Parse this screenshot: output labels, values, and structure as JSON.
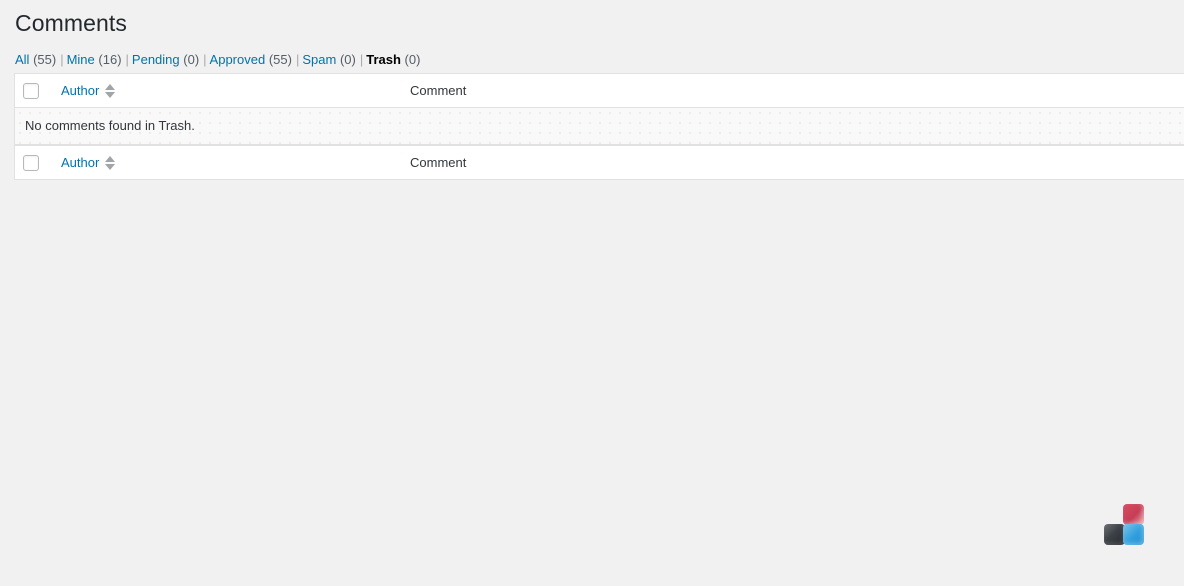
{
  "page": {
    "title": "Comments"
  },
  "views": {
    "separator": "|",
    "items": [
      {
        "label": "All",
        "count": "(55)",
        "current": false
      },
      {
        "label": "Mine",
        "count": "(16)",
        "current": false
      },
      {
        "label": "Pending",
        "count": "(0)",
        "current": false
      },
      {
        "label": "Approved",
        "count": "(55)",
        "current": false
      },
      {
        "label": "Spam",
        "count": "(0)",
        "current": false
      },
      {
        "label": "Trash",
        "count": "(0)",
        "current": true
      }
    ]
  },
  "table": {
    "select_all_label": "Select All",
    "columns": {
      "author": "Author",
      "comment": "Comment"
    },
    "no_items_message": "No comments found in Trash."
  },
  "colors": {
    "link": "#0073aa",
    "background": "#f1f1f1",
    "table_background": "#ffffff",
    "border": "#e1e1e1",
    "text": "#32373c",
    "tile_pink": "#c63d55",
    "tile_dark": "#24282c",
    "tile_blue": "#1f8ecd"
  },
  "icon_cluster": {
    "tiles": [
      {
        "name": "pink-tile"
      },
      {
        "name": "dark-tile"
      },
      {
        "name": "blue-tile"
      }
    ]
  }
}
